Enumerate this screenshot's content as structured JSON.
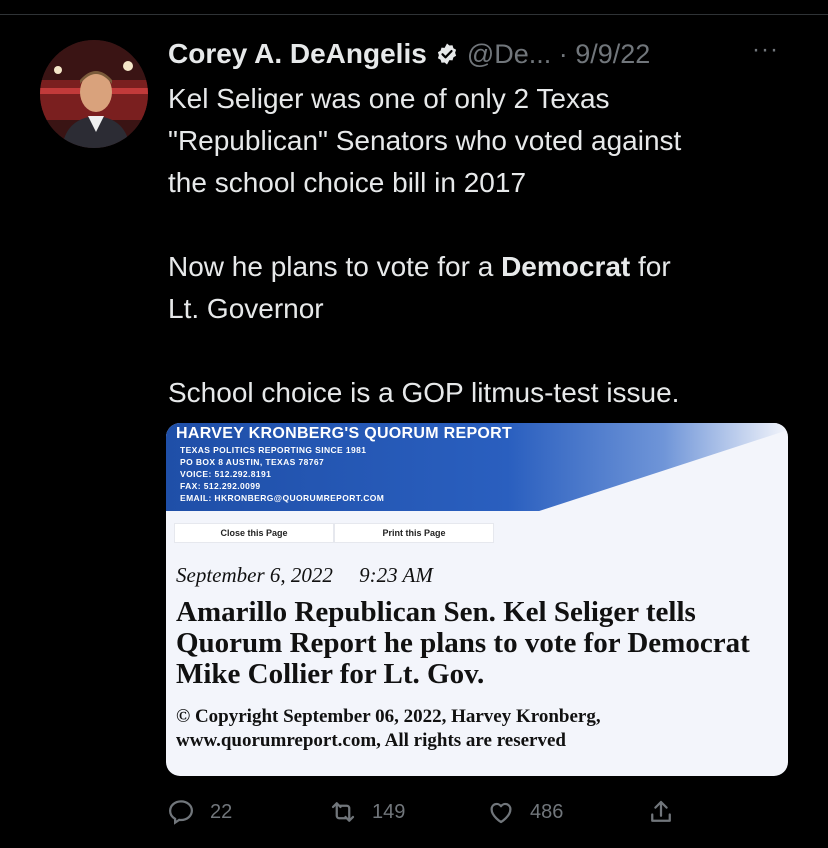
{
  "tweet": {
    "author_name": "Corey A. DeAngelis",
    "handle_date": "@De... · 9/9/22",
    "more_label": "···",
    "text_line1": "Kel Seliger was one of only 2 Texas\n\"Republican\" Senators who voted against\nthe school choice bill in 2017\n\nNow he plans to vote for a ",
    "text_bold": "Democrat",
    "text_line2": " for\nLt. Governor\n\nSchool choice is a GOP litmus-test issue."
  },
  "card": {
    "banner_title": "HARVEY KRONBERG'S QUORUM REPORT",
    "banner_lines": [
      "TEXAS POLITICS REPORTING SINCE 1981",
      "PO BOX 8 AUSTIN, TEXAS 78767",
      "VOICE: 512.292.8191",
      "FAX: 512.292.0099",
      "EMAIL: HKRONBERG@QUORUMREPORT.COM"
    ],
    "close_label": "Close this Page",
    "print_label": "Print this Page",
    "date": "September 6, 2022     9:23 AM",
    "headline": "Amarillo Republican Sen. Kel Seliger tells Quorum Report he plans to vote for Democrat Mike Collier for Lt. Gov.",
    "copyright": "© Copyright September 06, 2022, Harvey Kronberg, www.quorumreport.com, All rights are reserved"
  },
  "actions": {
    "replies": "22",
    "retweets": "149",
    "likes": "486"
  },
  "colors": {
    "background": "#000000",
    "text": "#e7e9ea",
    "muted": "#71767b",
    "verified": "#e7e9ea",
    "banner": "#1f4fa8"
  }
}
